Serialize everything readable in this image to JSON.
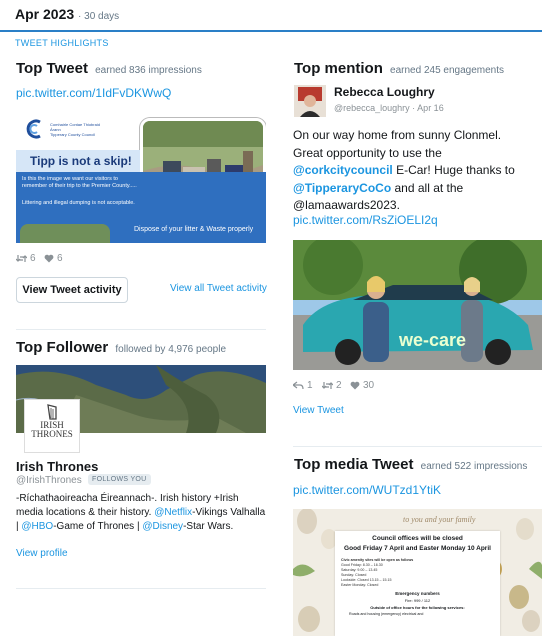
{
  "header": {
    "month": "Apr 2023",
    "period": "· 30 days"
  },
  "highlights_label": "TWEET HIGHLIGHTS",
  "top_tweet": {
    "title": "Top Tweet",
    "subtitle": "earned 836 impressions",
    "link": "pic.twitter.com/1IdFvDKWwQ",
    "poster": {
      "council_name": "Comhairle Contae Thiobraid Árann\nTipperary County Council",
      "headline": "Tipp is not a skip!",
      "body1": "Is this the image we want our visitors to remember of their trip to the Premier County.....",
      "body2": "Littering and illegal dumping is not acceptable.",
      "footer": "Dispose of your litter & Waste properly"
    },
    "retweets": "6",
    "likes": "6",
    "view_activity": "View Tweet activity",
    "view_all": "View all Tweet activity"
  },
  "top_mention": {
    "title": "Top mention",
    "subtitle": "earned 245 engagements",
    "name": "Rebecca Loughry",
    "handle": "@rebecca_loughry · Apr 16",
    "text_a": "On our way home from sunny Clonmel. Great opportunity to use the ",
    "mention1": "@corkcitycouncil",
    "text_b": " E-Car! Huge thanks to ",
    "mention2": "@TipperaryCoCo",
    "text_c": " and all at the @lamaawards2023.",
    "link": "pic.twitter.com/RsZiOELI2q",
    "car_brand": "we-care",
    "replies": "1",
    "retweets": "2",
    "likes": "30",
    "view_tweet": "View Tweet"
  },
  "top_follower": {
    "title": "Top Follower",
    "subtitle": "followed by 4,976 people",
    "logo_line1": "IRISH",
    "logo_line2": "THRONES",
    "name": "Irish Thrones",
    "handle": "@IrishThrones",
    "follows_badge": "FOLLOWS YOU",
    "bio_a": "-Ríchathaoireacha Éireannach-. Irish history +Irish media locations & their history. ",
    "bio_m1": "@Netflix",
    "bio_b": "-Vikings Valhalla | ",
    "bio_m2": "@HBO",
    "bio_c": "-Game of Thrones | ",
    "bio_m3": "@Disney",
    "bio_d": "-Star Wars.",
    "view_profile": "View profile"
  },
  "top_media": {
    "title": "Top media Tweet",
    "subtitle": "earned 522 impressions",
    "link": "pic.twitter.com/WUTzd1YtiK",
    "card": {
      "script": "to you and your family",
      "heading": "Council offices will be closed",
      "dates": "Good Friday 7 April and Easter Monday 10 April",
      "line1": "Civic amenity sites will be open as follows",
      "line2": "Good Friday: 8.30 – 16.30",
      "line3": "Saturday: 9.00 – 13.45",
      "line4": "Sunday: Closed",
      "line5": "Lookside: Closed 13.15 – 15.15",
      "line6": "Easter Monday: Closed",
      "line7": "Emergency numbers",
      "line8": "Fire: 999 / 112",
      "line9": "Outside of office hours for the following services:",
      "line10": "Roads and housing (emergency) electrical and"
    }
  },
  "colors": {
    "accent": "#1b95e0",
    "header_rule": "#2a7fc7",
    "poster_blue": "#2f6fbf",
    "car_teal": "#2aa7b0"
  }
}
